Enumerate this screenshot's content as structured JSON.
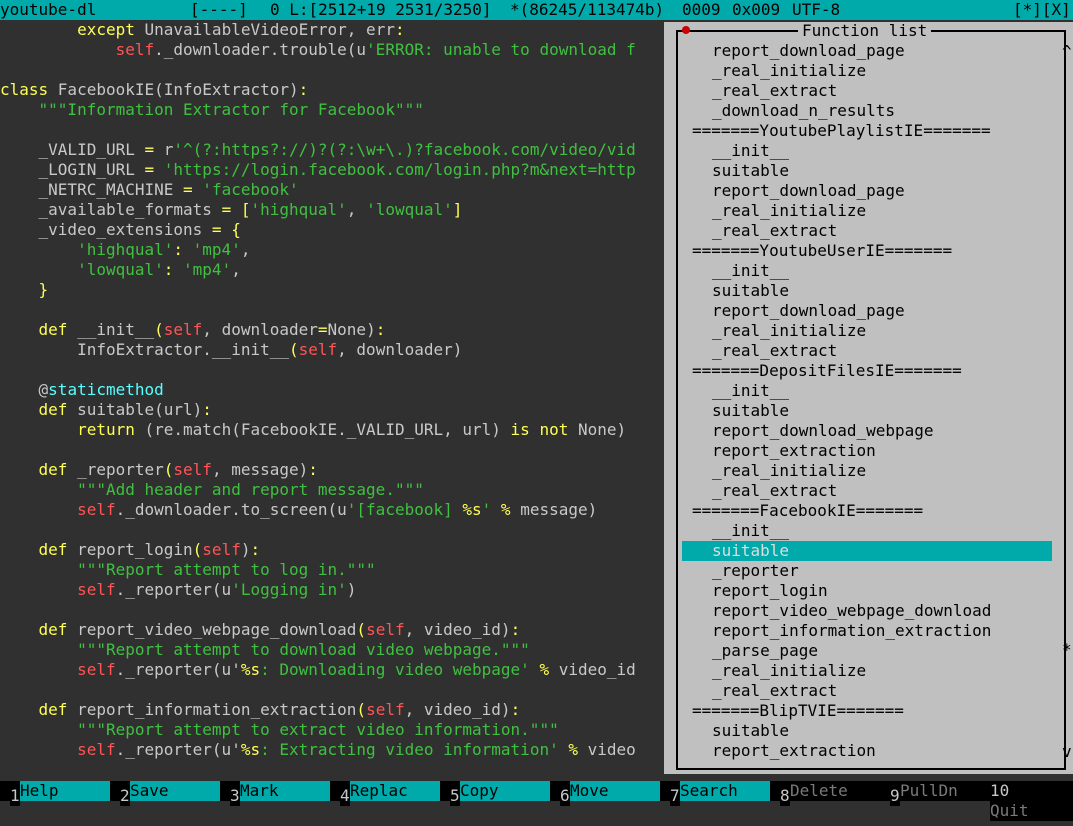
{
  "status": {
    "filename": "youtube-dl",
    "mode": "[----]",
    "position": "0 L:[2512+19 2531/3250]",
    "bytes": "*(86245/113474b)",
    "char_dec": "0009",
    "char_hex": "0x009",
    "encoding": "UTF-8",
    "controls": "[*][X]"
  },
  "code_lines": [
    [
      [
        "kw",
        "        except "
      ],
      [
        "txt",
        "UnavailableVideoError, err"
      ],
      [
        "op",
        ":"
      ]
    ],
    [
      [
        "slf",
        "            self"
      ],
      [
        "txt",
        "._downloader.trouble(u"
      ],
      [
        "str",
        "'ERROR: unable to download f"
      ]
    ],
    [],
    [
      [
        "kw",
        "class "
      ],
      [
        "txt",
        "FacebookIE(InfoExtractor)"
      ],
      [
        "op",
        ":"
      ]
    ],
    [
      [
        "str",
        "    \"\"\"Information Extractor for Facebook\"\"\""
      ]
    ],
    [],
    [
      [
        "txt",
        "    _VALID_URL "
      ],
      [
        "op",
        "="
      ],
      [
        "txt",
        " r"
      ],
      [
        "str",
        "'^(?:https?://)?(?:\\w+\\.)?facebook.com/video/vid"
      ]
    ],
    [
      [
        "txt",
        "    _LOGIN_URL "
      ],
      [
        "op",
        "="
      ],
      [
        "str",
        " 'https://login.facebook.com/login.php?m&next=http"
      ]
    ],
    [
      [
        "txt",
        "    _NETRC_MACHINE "
      ],
      [
        "op",
        "="
      ],
      [
        "str",
        " 'facebook'"
      ]
    ],
    [
      [
        "txt",
        "    _available_formats "
      ],
      [
        "op",
        "= ["
      ],
      [
        "str",
        "'highqual'"
      ],
      [
        "txt",
        ", "
      ],
      [
        "str",
        "'lowqual'"
      ],
      [
        "op",
        "]"
      ]
    ],
    [
      [
        "txt",
        "    _video_extensions "
      ],
      [
        "op",
        "= {"
      ]
    ],
    [
      [
        "str",
        "        'highqual'"
      ],
      [
        "op",
        ": "
      ],
      [
        "str",
        "'mp4'"
      ],
      [
        "txt",
        ","
      ]
    ],
    [
      [
        "str",
        "        'lowqual'"
      ],
      [
        "op",
        ": "
      ],
      [
        "str",
        "'mp4'"
      ],
      [
        "txt",
        ","
      ]
    ],
    [
      [
        "op",
        "    }"
      ]
    ],
    [],
    [
      [
        "kw",
        "    def "
      ],
      [
        "txt",
        "__init__"
      ],
      [
        "op",
        "("
      ],
      [
        "slf",
        "self"
      ],
      [
        "txt",
        ", downloader"
      ],
      [
        "op",
        "="
      ],
      [
        "txt",
        "None)"
      ],
      [
        "op",
        ":"
      ]
    ],
    [
      [
        "txt",
        "        InfoExtractor.__init__"
      ],
      [
        "op",
        "("
      ],
      [
        "slf",
        "self"
      ],
      [
        "txt",
        ", downloader)"
      ]
    ],
    [],
    [
      [
        "txt",
        "    @"
      ],
      [
        "dec",
        "staticmethod"
      ]
    ],
    [
      [
        "kw",
        "    def "
      ],
      [
        "txt",
        "suitable(url)"
      ],
      [
        "op",
        ":"
      ]
    ],
    [
      [
        "kw",
        "        return "
      ],
      [
        "txt",
        "(re.match(FacebookIE._VALID_URL, url) "
      ],
      [
        "kw",
        "is not "
      ],
      [
        "txt",
        "None)"
      ]
    ],
    [],
    [
      [
        "kw",
        "    def "
      ],
      [
        "txt",
        "_reporter"
      ],
      [
        "op",
        "("
      ],
      [
        "slf",
        "self"
      ],
      [
        "txt",
        ", message)"
      ],
      [
        "op",
        ":"
      ]
    ],
    [
      [
        "str",
        "        \"\"\"Add header and report message.\"\"\""
      ]
    ],
    [
      [
        "slf",
        "        self"
      ],
      [
        "txt",
        "._downloader.to_screen(u"
      ],
      [
        "str",
        "'[facebook] "
      ],
      [
        "fmt",
        "%s"
      ],
      [
        "str",
        "'"
      ],
      [
        "op",
        " % "
      ],
      [
        "txt",
        "message)"
      ]
    ],
    [],
    [
      [
        "kw",
        "    def "
      ],
      [
        "txt",
        "report_login"
      ],
      [
        "op",
        "("
      ],
      [
        "slf",
        "self"
      ],
      [
        "txt",
        ")"
      ],
      [
        "op",
        ":"
      ]
    ],
    [
      [
        "str",
        "        \"\"\"Report attempt to log in.\"\"\""
      ]
    ],
    [
      [
        "slf",
        "        self"
      ],
      [
        "txt",
        "._reporter(u"
      ],
      [
        "str",
        "'Logging in'"
      ],
      [
        "txt",
        ")"
      ]
    ],
    [],
    [
      [
        "kw",
        "    def "
      ],
      [
        "txt",
        "report_video_webpage_download"
      ],
      [
        "op",
        "("
      ],
      [
        "slf",
        "self"
      ],
      [
        "txt",
        ", video_id)"
      ],
      [
        "op",
        ":"
      ]
    ],
    [
      [
        "str",
        "        \"\"\"Report attempt to download video webpage.\"\"\""
      ]
    ],
    [
      [
        "slf",
        "        self"
      ],
      [
        "txt",
        "._reporter(u'"
      ],
      [
        "fmt",
        "%s"
      ],
      [
        "str",
        ": Downloading video webpage'"
      ],
      [
        "op",
        " % "
      ],
      [
        "txt",
        "video_id"
      ]
    ],
    [],
    [
      [
        "kw",
        "    def "
      ],
      [
        "txt",
        "report_information_extraction"
      ],
      [
        "op",
        "("
      ],
      [
        "slf",
        "self"
      ],
      [
        "txt",
        ", video_id)"
      ],
      [
        "op",
        ":"
      ]
    ],
    [
      [
        "str",
        "        \"\"\"Report attempt to extract video information.\"\"\""
      ]
    ],
    [
      [
        "slf",
        "        self"
      ],
      [
        "txt",
        "._reporter(u'"
      ],
      [
        "fmt",
        "%s"
      ],
      [
        "str",
        ": Extracting video information'"
      ],
      [
        "op",
        " % "
      ],
      [
        "txt",
        "video"
      ]
    ]
  ],
  "function_list": {
    "title": "Function list",
    "scroll_up": "^",
    "scroll_down": "v",
    "marker": "*",
    "items": [
      {
        "label": "report_download_page",
        "group": false
      },
      {
        "label": "_real_initialize",
        "group": false
      },
      {
        "label": "_real_extract",
        "group": false
      },
      {
        "label": "_download_n_results",
        "group": false
      },
      {
        "label": "=======YoutubePlaylistIE=======",
        "group": true
      },
      {
        "label": "__init__",
        "group": false
      },
      {
        "label": "suitable",
        "group": false
      },
      {
        "label": "report_download_page",
        "group": false
      },
      {
        "label": "_real_initialize",
        "group": false
      },
      {
        "label": "_real_extract",
        "group": false
      },
      {
        "label": "=======YoutubeUserIE=======",
        "group": true
      },
      {
        "label": "__init__",
        "group": false
      },
      {
        "label": "suitable",
        "group": false
      },
      {
        "label": "report_download_page",
        "group": false
      },
      {
        "label": "_real_initialize",
        "group": false
      },
      {
        "label": "_real_extract",
        "group": false
      },
      {
        "label": "=======DepositFilesIE=======",
        "group": true
      },
      {
        "label": "__init__",
        "group": false
      },
      {
        "label": "suitable",
        "group": false
      },
      {
        "label": "report_download_webpage",
        "group": false
      },
      {
        "label": "report_extraction",
        "group": false
      },
      {
        "label": "_real_initialize",
        "group": false
      },
      {
        "label": "_real_extract",
        "group": false
      },
      {
        "label": "=======FacebookIE=======",
        "group": true
      },
      {
        "label": "__init__",
        "group": false
      },
      {
        "label": "suitable",
        "group": false,
        "selected": true
      },
      {
        "label": "_reporter",
        "group": false
      },
      {
        "label": "report_login",
        "group": false
      },
      {
        "label": "report_video_webpage_download",
        "group": false
      },
      {
        "label": "report_information_extraction",
        "group": false
      },
      {
        "label": "_parse_page",
        "group": false
      },
      {
        "label": "_real_initialize",
        "group": false
      },
      {
        "label": "_real_extract",
        "group": false
      },
      {
        "label": "=======BlipTVIE=======",
        "group": true
      },
      {
        "label": "suitable",
        "group": false
      },
      {
        "label": "report_extraction",
        "group": false
      }
    ]
  },
  "fkeys": [
    {
      "num": "1",
      "label": "Help",
      "active": true
    },
    {
      "num": "2",
      "label": "Save",
      "active": true
    },
    {
      "num": "3",
      "label": "Mark",
      "active": true
    },
    {
      "num": "4",
      "label": "Replac",
      "active": true
    },
    {
      "num": "5",
      "label": "Copy",
      "active": true
    },
    {
      "num": "6",
      "label": "Move",
      "active": true
    },
    {
      "num": "7",
      "label": "Search",
      "active": true
    },
    {
      "num": "8",
      "label": "Delete",
      "active": false
    },
    {
      "num": "9",
      "label": "PullDn",
      "active": false
    },
    {
      "num": "10",
      "label": "Quit",
      "active": false
    }
  ]
}
